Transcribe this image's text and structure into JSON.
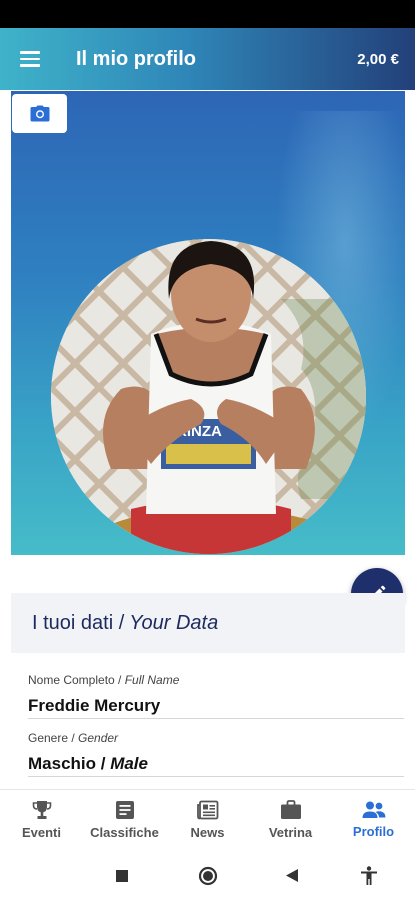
{
  "appbar": {
    "title": "Il mio profilo",
    "balance": "2,00 €",
    "menu_icon": "hamburger-menu-icon"
  },
  "cover": {
    "camera_icon": "camera-icon",
    "edit_icon": "pencil-icon"
  },
  "data_section": {
    "title_it": "I tuoi dati / ",
    "title_en": "Your Data"
  },
  "fields": [
    {
      "label_it": "Nome Completo / ",
      "label_en": "Full Name",
      "value": "Freddie Mercury"
    },
    {
      "label_it": "Genere / ",
      "label_en": "Gender",
      "value_it": "Maschio / ",
      "value_en": "Male"
    }
  ],
  "bottom_nav": [
    {
      "label": "Eventi",
      "icon": "trophy-icon",
      "active": false
    },
    {
      "label": "Classifiche",
      "icon": "list-icon",
      "active": false
    },
    {
      "label": "News",
      "icon": "newspaper-icon",
      "active": false
    },
    {
      "label": "Vetrina",
      "icon": "briefcase-icon",
      "active": false
    },
    {
      "label": "Profilo",
      "icon": "people-icon",
      "active": true
    }
  ],
  "colors": {
    "accent": "#2b6fd6",
    "fab": "#1e2f6b",
    "header_text": "#1e2a5e"
  }
}
